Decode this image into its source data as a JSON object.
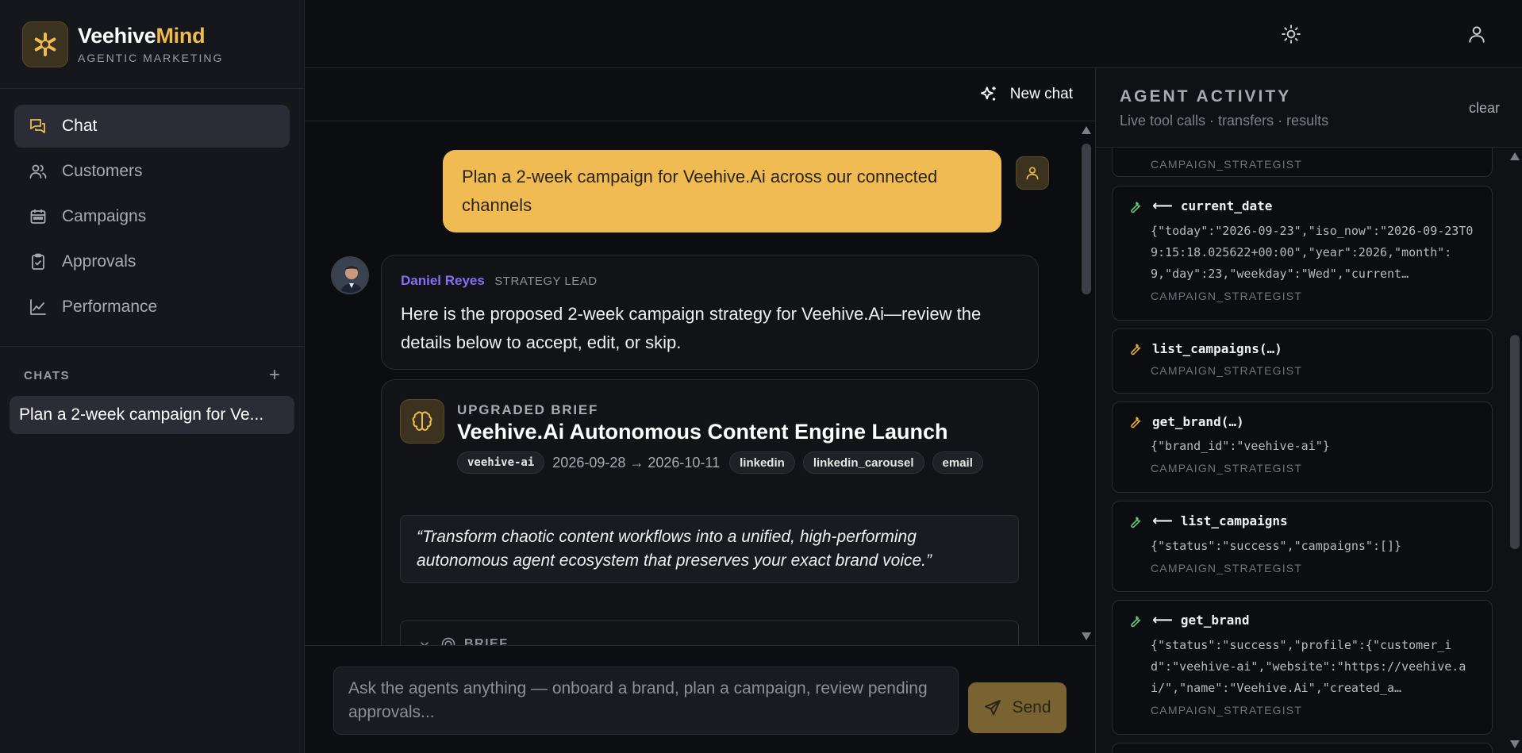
{
  "brand": {
    "name_part1": "Veehive",
    "name_part2": "Mind",
    "tagline": "AGENTIC MARKETING",
    "accent_color": "#f0bb4e"
  },
  "nav": {
    "items": [
      {
        "label": "Chat",
        "icon": "chat-bubbles-icon",
        "active": true
      },
      {
        "label": "Customers",
        "icon": "users-icon",
        "active": false
      },
      {
        "label": "Campaigns",
        "icon": "calendar-icon",
        "active": false
      },
      {
        "label": "Approvals",
        "icon": "clipboard-check-icon",
        "active": false
      },
      {
        "label": "Performance",
        "icon": "line-chart-icon",
        "active": false
      }
    ]
  },
  "chats": {
    "label": "CHATS",
    "add_symbol": "+",
    "items": [
      {
        "title": "Plan a 2-week campaign for Ve..."
      }
    ]
  },
  "topbar": {
    "theme_icon": "sun-icon",
    "profile_icon": "user-icon"
  },
  "chat": {
    "new_chat_label": "New chat",
    "user_message": "Plan a 2-week campaign for Veehive.Ai across our connected channels",
    "agent": {
      "name": "Daniel Reyes",
      "role": "STRATEGY LEAD",
      "message": "Here is the proposed 2-week campaign strategy for Veehive.Ai—review the details below to accept, edit, or skip."
    },
    "brief": {
      "kicker": "UPGRADED BRIEF",
      "title": "Veehive.Ai Autonomous Content Engine Launch",
      "brand_chip": "veehive-ai",
      "dates": "2026-09-28 → 2026-10-11",
      "channels": [
        "linkedin",
        "linkedin_carousel",
        "email"
      ],
      "quote": "“Transform chaotic content workflows into a unified, high-performing autonomous agent ecosystem that preserves your exact brand voice.”",
      "section_label": "BRIEF"
    }
  },
  "composer": {
    "placeholder": "Ask the agents anything — onboard a brand, plan a campaign, review pending approvals...",
    "send_label": "Send"
  },
  "activity": {
    "title": "AGENT ACTIVITY",
    "subtitle": "Live tool calls · transfers · results",
    "clear_label": "clear",
    "cards": [
      {
        "tool": "",
        "arrow": "",
        "json": "",
        "agent": "CAMPAIGN_STRATEGIST"
      },
      {
        "tool": "current_date",
        "arrow": "⟵",
        "json": "{\"today\":\"2026-09-23\",\"iso_now\":\"2026-09-23T09:15:18.025622+00:00\",\"year\":2026,\"month\":9,\"day\":23,\"weekday\":\"Wed\",\"current…",
        "agent": "CAMPAIGN_STRATEGIST"
      },
      {
        "tool": "list_campaigns(…)",
        "arrow": "",
        "json": "",
        "agent": "CAMPAIGN_STRATEGIST"
      },
      {
        "tool": "get_brand(…)",
        "arrow": "",
        "json": "{\"brand_id\":\"veehive-ai\"}",
        "agent": "CAMPAIGN_STRATEGIST"
      },
      {
        "tool": "list_campaigns",
        "arrow": "⟵",
        "json": "{\"status\":\"success\",\"campaigns\":[]}",
        "agent": "CAMPAIGN_STRATEGIST"
      },
      {
        "tool": "get_brand",
        "arrow": "⟵",
        "json": "{\"status\":\"success\",\"profile\":{\"customer_id\":\"veehive-ai\",\"website\":\"https://veehive.ai/\",\"name\":\"Veehive.Ai\",\"created_a…",
        "agent": "CAMPAIGN_STRATEGIST"
      }
    ]
  }
}
